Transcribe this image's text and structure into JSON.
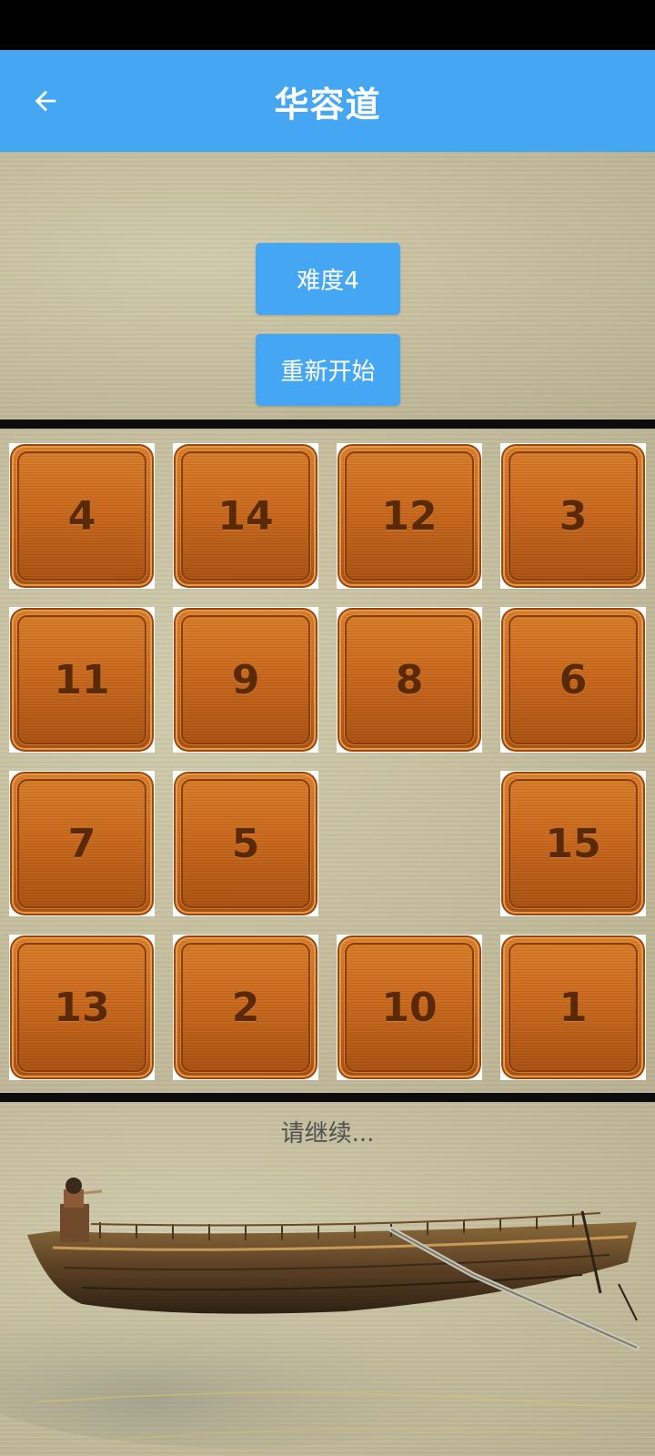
{
  "header": {
    "title": "华容道",
    "back_icon": "arrow-left-icon",
    "color": "#45a6f4"
  },
  "controls": {
    "difficulty_label": "难度4",
    "restart_label": "重新开始"
  },
  "board": {
    "rows": 4,
    "cols": 4,
    "tiles": [
      [
        "4",
        "14",
        "12",
        "3"
      ],
      [
        "11",
        "9",
        "8",
        "6"
      ],
      [
        "7",
        "5",
        "",
        "15"
      ],
      [
        "13",
        "2",
        "10",
        "1"
      ]
    ],
    "tile_color": "#c8681d",
    "number_color": "#5a2a06"
  },
  "footer": {
    "status_text": "请继续...",
    "illustration": "wooden-boat-ink-painting"
  }
}
